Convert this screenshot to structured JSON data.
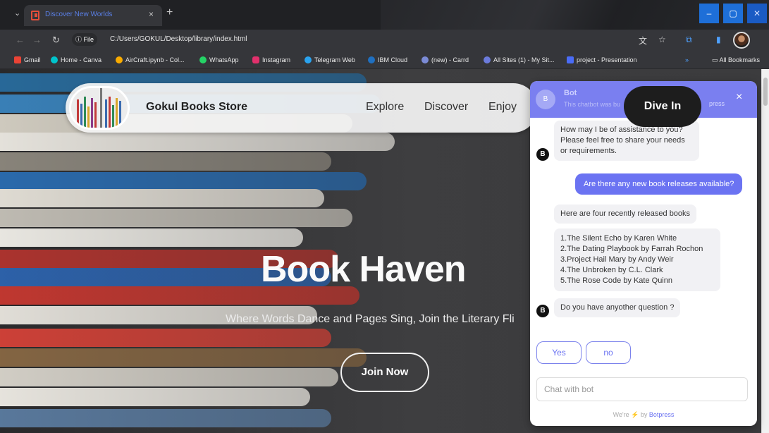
{
  "browser": {
    "tab_title": "Discover New Worlds",
    "tab_close": "×",
    "new_tab": "+",
    "menu_caret": "⌄",
    "file_label": "ⓘ File",
    "url": "C:/Users/GOKUL/Desktop/library/index.html",
    "window": {
      "minimize": "–",
      "maximize": "▢",
      "close": "✕"
    }
  },
  "bookmarks": [
    {
      "label": "Gmail",
      "color": "#ea4335"
    },
    {
      "label": "Home - Canva",
      "color": "#00c4cc"
    },
    {
      "label": "AirCraft.ipynb - Col...",
      "color": "#f9ab00"
    },
    {
      "label": "WhatsApp",
      "color": "#25d366"
    },
    {
      "label": "Instagram",
      "color": "#e1306c"
    },
    {
      "label": "Telegram Web",
      "color": "#2aa3ef"
    },
    {
      "label": "IBM Cloud",
      "color": "#1f70c1"
    },
    {
      "label": "(new) - Carrd",
      "color": "#7b8bd6"
    },
    {
      "label": "All Sites (1) - My Sit...",
      "color": "#6b7bdc"
    },
    {
      "label": "project - Presentation",
      "color": "#4a6cf7"
    }
  ],
  "bookmarks_more": "»",
  "bookmarks_folder": "All Bookmarks",
  "site": {
    "brand": "Gokul Books Store",
    "nav": [
      "Explore",
      "Discover",
      "Enjoy"
    ],
    "cta_nav": "Dive In",
    "hero_title": "Book Haven",
    "hero_subtitle": "Where Words Dance and Pages Sing, Join the Literary Fli",
    "join_button": "Join Now"
  },
  "chat": {
    "avatar_letter": "B",
    "bot_name": "Bot",
    "bot_desc": "This chatbot was bu",
    "bot_press": "press",
    "close": "×",
    "messages": {
      "greeting": "How may I be of assistance to you? Please feel free to share your needs or requirements.",
      "user_question": "Are there any new book releases available?",
      "intro": "Here are four recently released books",
      "book_list": [
        "1.The Silent Echo by Karen White",
        "2.The Dating Playbook by Farrah Rochon",
        "3.Project Hail Mary by Andy Weir",
        "4.The Unbroken by C.L. Clark",
        "5.The Rose Code by Kate Quinn"
      ],
      "followup": "Do you have anyother question ?"
    },
    "options": [
      "Yes",
      "no"
    ],
    "input_placeholder": "Chat with bot",
    "powered_prefix": "We're",
    "powered_bolt": "⚡",
    "powered_by": "by",
    "powered_brand": "Botpress"
  }
}
